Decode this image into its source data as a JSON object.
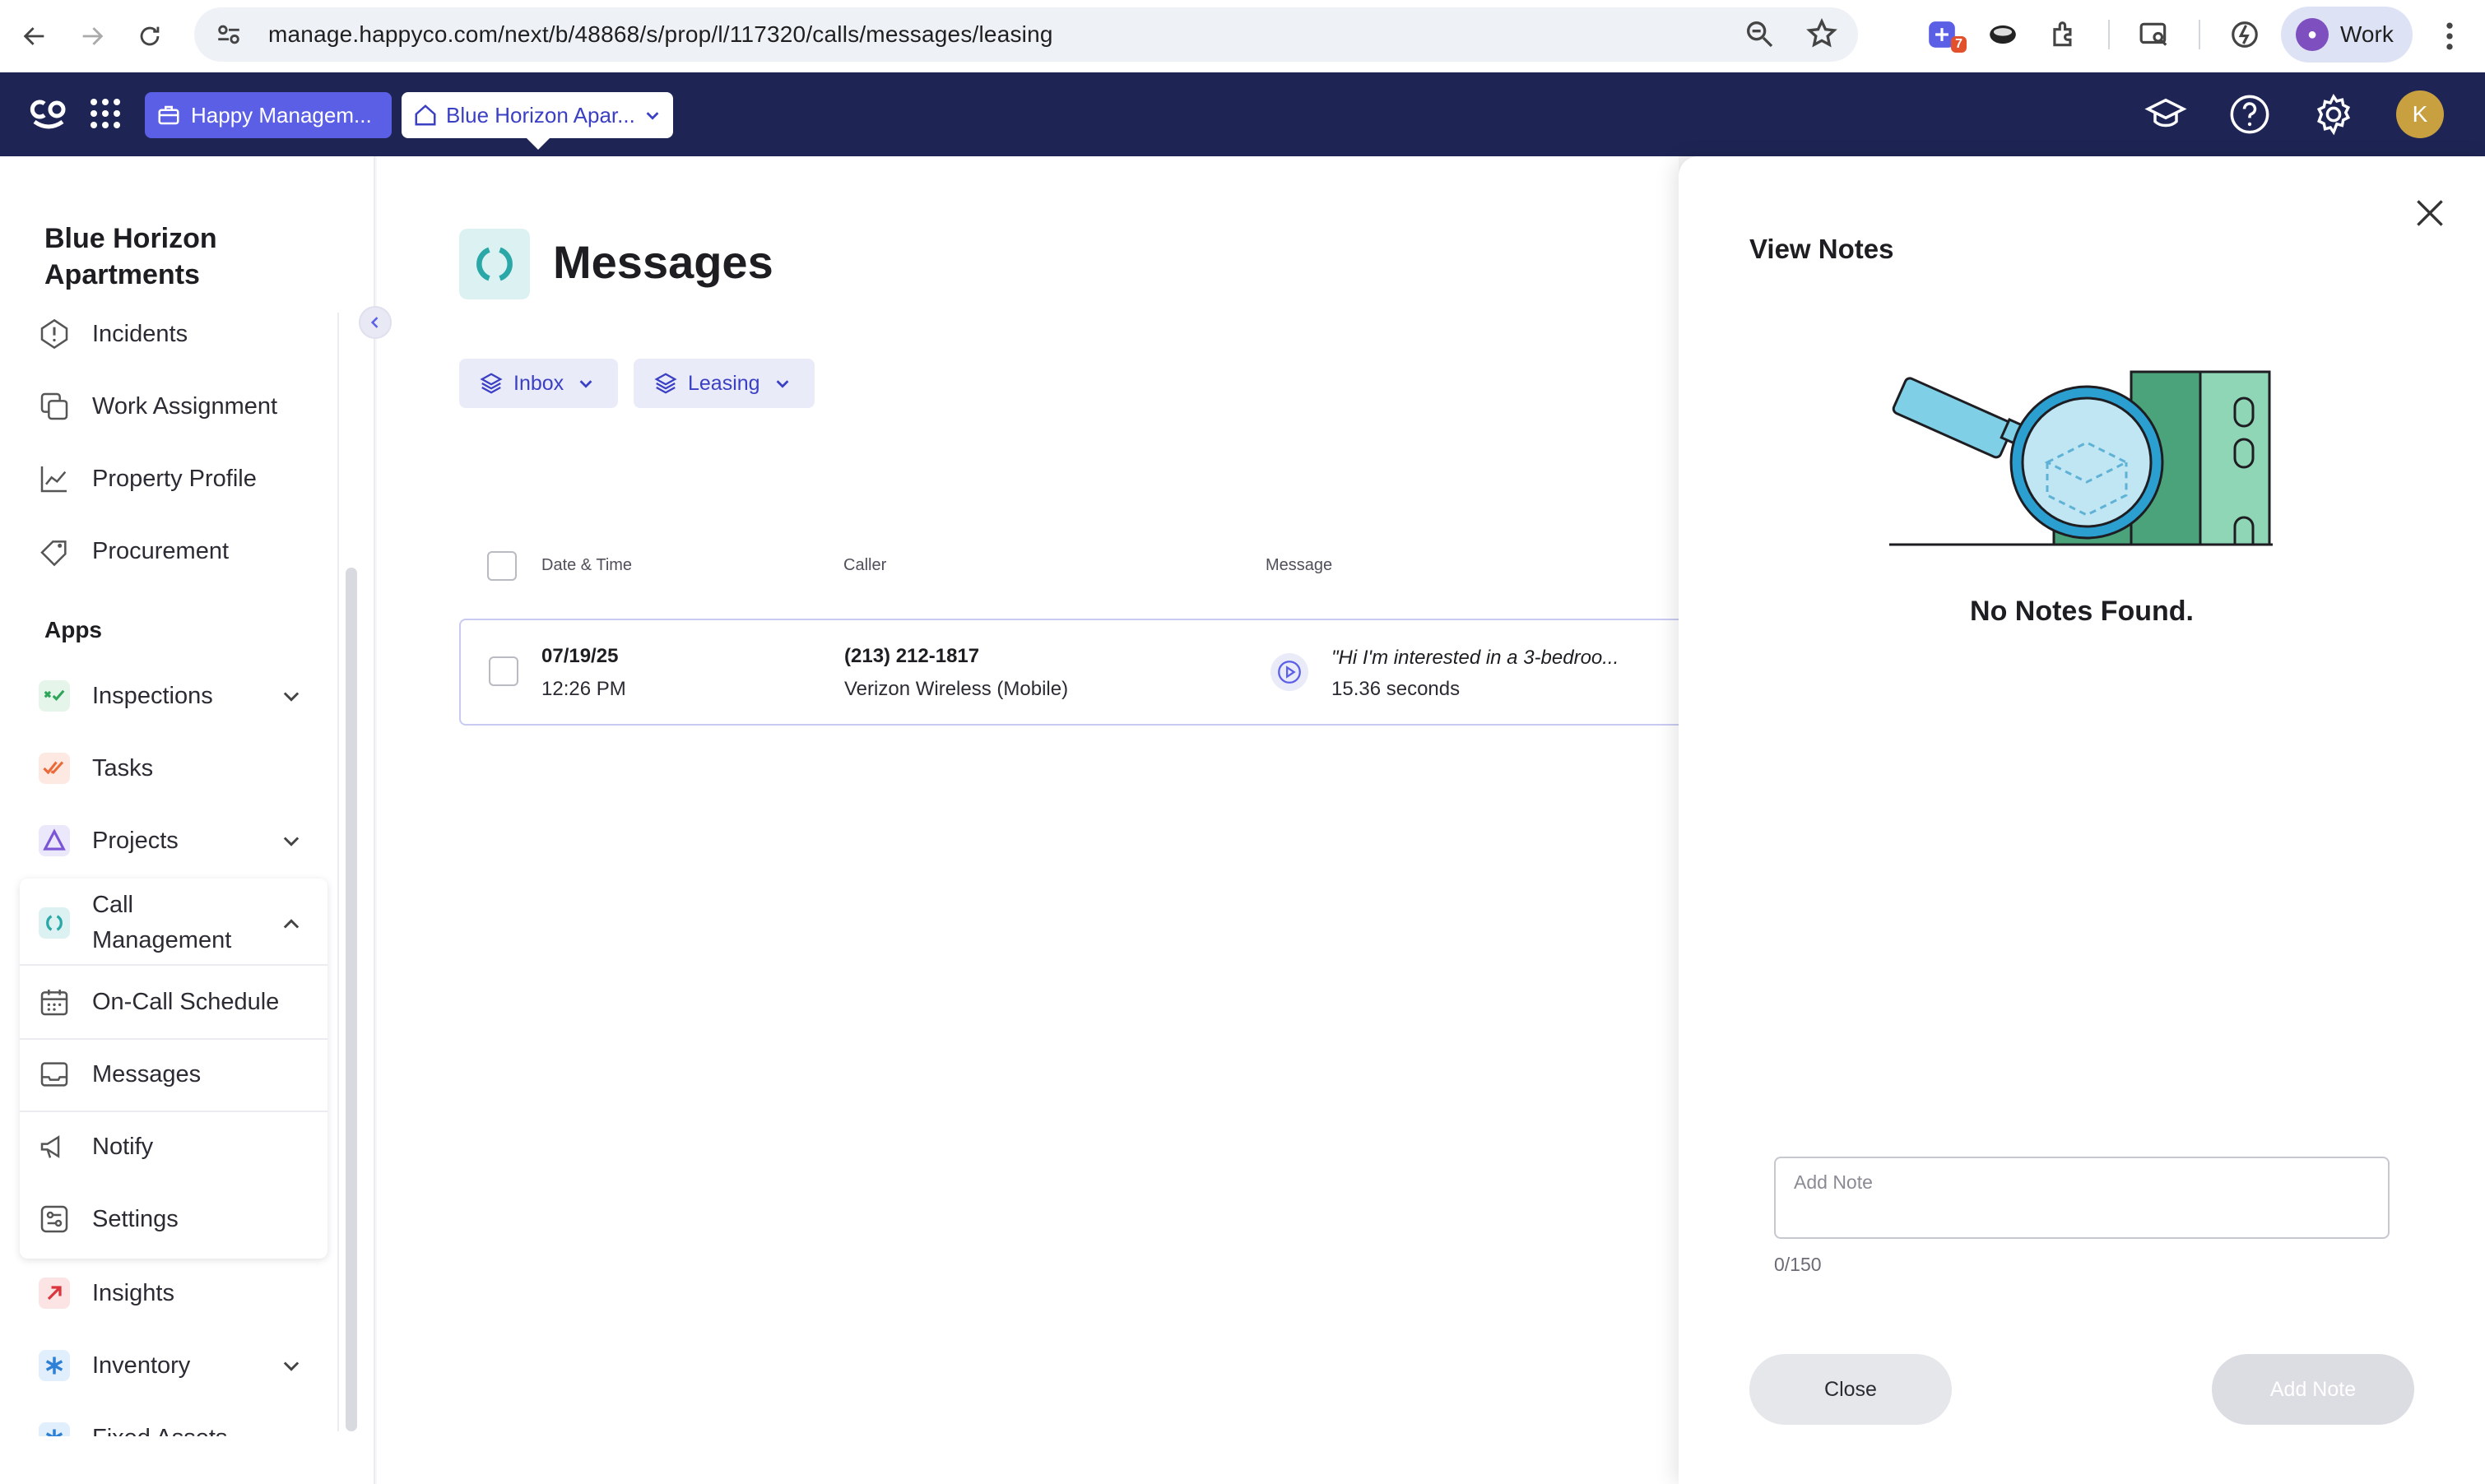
{
  "browser": {
    "url": "manage.happyco.com/next/b/48868/s/prop/l/117320/calls/messages/leasing",
    "extension_badge": "7",
    "profile_label": "Work"
  },
  "header": {
    "org_label": "Happy Managem...",
    "property_label": "Blue Horizon Apar...",
    "avatar_initial": "K",
    "colors": {
      "header_bg": "#1e2554",
      "org_pill": "#5b5fe6"
    }
  },
  "sidebar": {
    "title": "Blue Horizon Apartments",
    "items": [
      {
        "label": "Incidents",
        "icon": "alert-circle-icon"
      },
      {
        "label": "Work Assignment",
        "icon": "work-assignment-icon"
      },
      {
        "label": "Property Profile",
        "icon": "chart-line-icon"
      },
      {
        "label": "Procurement",
        "icon": "tag-icon"
      }
    ],
    "apps_label": "Apps",
    "apps": [
      {
        "label": "Inspections",
        "icon": "inspections-icon",
        "expandable": true
      },
      {
        "label": "Tasks",
        "icon": "tasks-icon",
        "expandable": false
      },
      {
        "label": "Projects",
        "icon": "projects-icon",
        "expandable": true
      },
      {
        "label": "Call Management",
        "icon": "call-management-icon",
        "expanded": true
      },
      {
        "label": "Insights",
        "icon": "insights-icon",
        "expandable": false
      },
      {
        "label": "Inventory",
        "icon": "inventory-icon",
        "expandable": true
      },
      {
        "label": "Fixed Assets",
        "icon": "fixed-assets-icon",
        "expandable": false
      }
    ],
    "call_management_subitems": [
      {
        "label": "On-Call Schedule",
        "icon": "calendar-icon"
      },
      {
        "label": "Messages",
        "icon": "inbox-icon",
        "active": true
      },
      {
        "label": "Notify",
        "icon": "megaphone-icon"
      },
      {
        "label": "Settings",
        "icon": "sliders-icon"
      }
    ]
  },
  "main": {
    "title": "Messages",
    "filters": [
      {
        "label": "Inbox"
      },
      {
        "label": "Leasing"
      }
    ],
    "table": {
      "columns": [
        "Date & Time",
        "Caller",
        "Message"
      ],
      "rows": [
        {
          "date": "07/19/25",
          "time": "12:26 PM",
          "caller_number": "(213) 212-1817",
          "caller_carrier": "Verizon Wireless (Mobile)",
          "message_preview": "\"Hi I'm interested in a 3-bedroo...",
          "message_duration": "15.36 seconds"
        }
      ]
    }
  },
  "notes_panel": {
    "title": "View Notes",
    "empty_text": "No Notes Found.",
    "input_placeholder": "Add Note",
    "input_value": "",
    "char_count": "0/150",
    "close_label": "Close",
    "add_label": "Add Note"
  }
}
